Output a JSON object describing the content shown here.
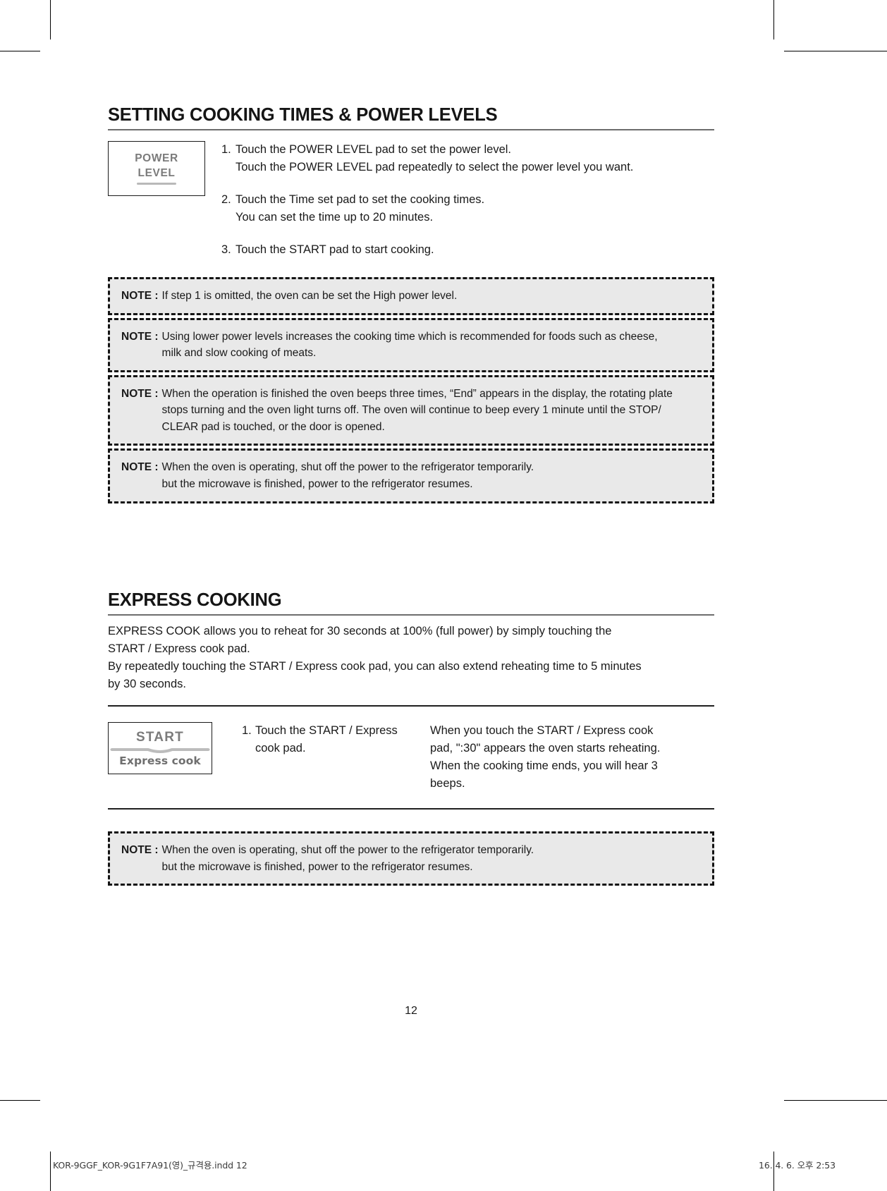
{
  "section1": {
    "heading": "SETTING COOKING TIMES & POWER LEVELS",
    "pad": {
      "line1": "POWER",
      "line2": "LEVEL"
    },
    "steps": [
      {
        "num": "1.",
        "line1": "Touch the POWER LEVEL pad to set the power level.",
        "line2": "Touch the POWER LEVEL pad repeatedly to select the power level you want."
      },
      {
        "num": "2.",
        "line1": "Touch the Time set pad to set the cooking times.",
        "line2": "You can set the time up to 20 minutes."
      },
      {
        "num": "3.",
        "line1": "Touch the START pad to start cooking.",
        "line2": ""
      }
    ],
    "notes": [
      {
        "label": "NOTE :",
        "lines": [
          "If step 1 is omitted, the oven can be set the High power level."
        ]
      },
      {
        "label": "NOTE :",
        "lines": [
          "Using lower power levels increases the cooking time which is recommended for foods such as cheese,",
          "milk and slow cooking of meats."
        ]
      },
      {
        "label": "NOTE :",
        "lines": [
          "When the operation is finished the oven beeps three times, “End” appears in the display, the rotating plate",
          "stops turning and the oven light turns off. The oven will continue to beep every 1 minute until the STOP/",
          "CLEAR pad is touched, or the door is opened."
        ]
      },
      {
        "label": "NOTE :",
        "lines": [
          "When the oven is operating, shut off the power to the refrigerator temporarily.",
          "but the microwave is finished, power to the refrigerator resumes."
        ]
      }
    ]
  },
  "section2": {
    "heading": "EXPRESS COOKING",
    "intro": [
      "EXPRESS COOK allows you to reheat for 30 seconds at 100% (full power) by simply touching the",
      "START / Express cook pad.",
      "By repeatedly touching the START / Express cook pad, you can also extend reheating time to 5 minutes",
      "by 30 seconds."
    ],
    "pad": {
      "line1": "START",
      "line2": "Express cook"
    },
    "step": {
      "num": "1.",
      "line1": "Touch the START / Express",
      "line2": "cook pad."
    },
    "description": [
      "When you touch the START / Express cook",
      "pad, \":30\" appears the oven starts reheating.",
      "When the cooking time ends, you will hear 3",
      "beeps."
    ],
    "note": {
      "label": "NOTE :",
      "lines": [
        "When the oven is operating, shut off the power to the refrigerator temporarily.",
        "but the microwave is finished, power to the refrigerator resumes."
      ]
    }
  },
  "page_number": "12",
  "footer": {
    "file": "KOR-9GGF_KOR-9G1F7A91(영)_규격용.indd   12",
    "timestamp": "16. 4. 6.   오후 2:53"
  },
  "colors": {
    "note_fill": "#e9e9e9",
    "note_border": "#141414",
    "rule_gray": "#6d6d6d",
    "pad_text": "#7b7b7b"
  }
}
